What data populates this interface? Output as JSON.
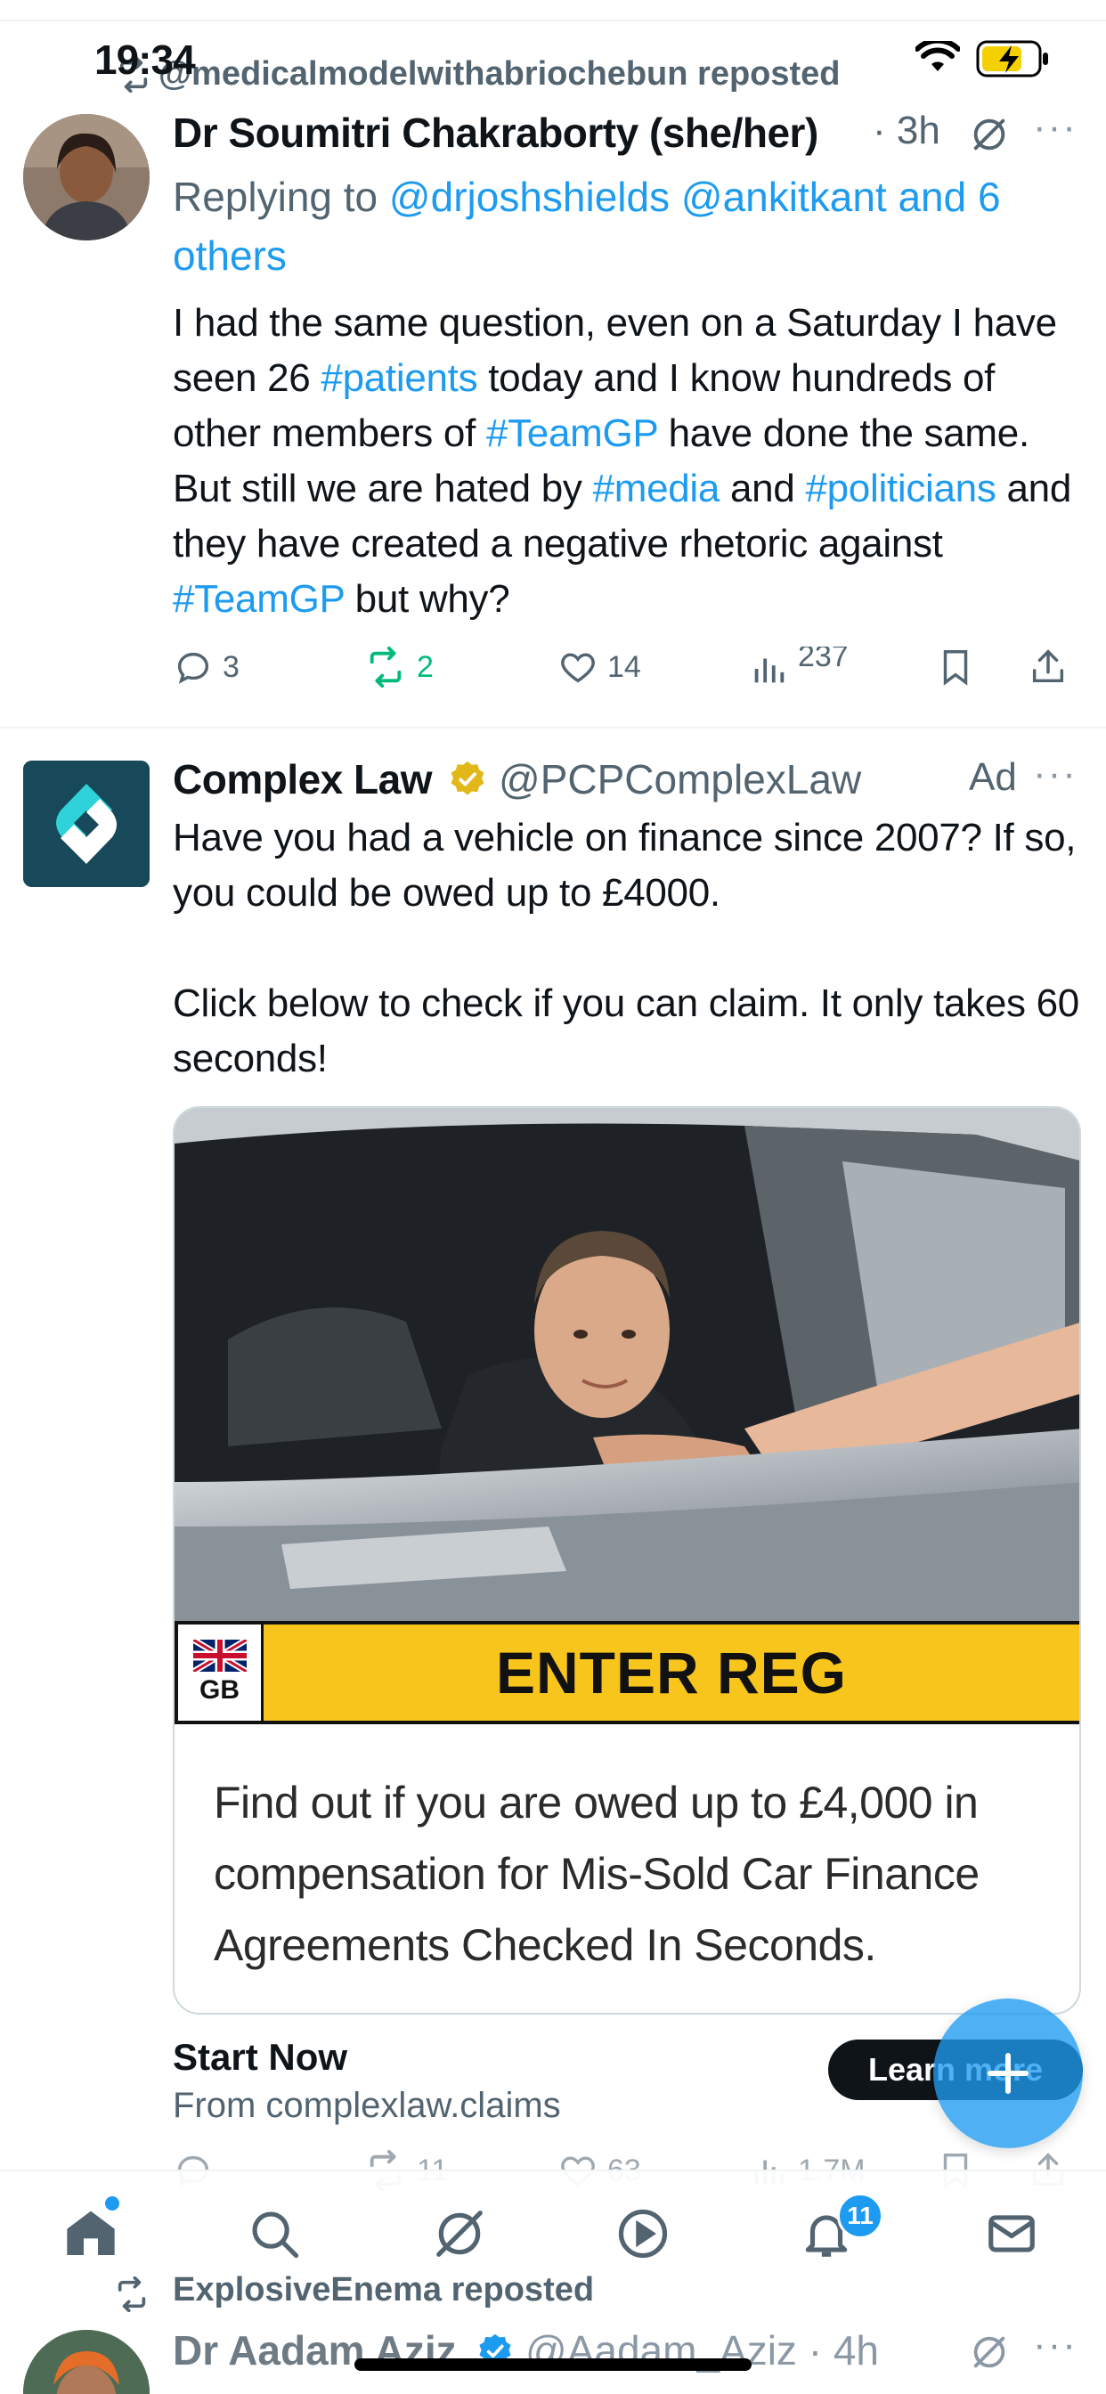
{
  "status_bar": {
    "time": "19:34"
  },
  "tweet1": {
    "repost_text": "@medicalmodelwithabriochebun reposted",
    "author_name": "Dr Soumitri Chakraborty (she/her)",
    "time": "· 3h",
    "reply_prefix": "Replying to ",
    "reply_mentions": "@drjoshshields @ankitkant and 6 others",
    "body_segments": [
      {
        "text": "I had the same question, even on a Saturday I have seen 26 ",
        "link": false
      },
      {
        "text": "#patients",
        "link": true
      },
      {
        "text": " today and I know hundreds of other members of ",
        "link": false
      },
      {
        "text": "#TeamGP",
        "link": true
      },
      {
        "text": " have done the same. But still we are hated by ",
        "link": false
      },
      {
        "text": "#media",
        "link": true
      },
      {
        "text": " and ",
        "link": false
      },
      {
        "text": "#politicians",
        "link": true
      },
      {
        "text": " and they have created a negative rhetoric against ",
        "link": false
      },
      {
        "text": "#TeamGP",
        "link": true
      },
      {
        "text": " but why?",
        "link": false
      }
    ],
    "replies": "3",
    "reposts": "2",
    "likes": "14",
    "views": "237"
  },
  "tweet2": {
    "author_name": "Complex Law",
    "handle": "@PCPComplexLaw",
    "ad_label": "Ad",
    "body": "Have you had a vehicle on finance since 2007? If so, you could be owed up to £4000.\n\nClick below to check if you can claim. It only takes 60 seconds!",
    "card": {
      "plate_country": "GB",
      "plate_cta": "ENTER REG",
      "description": "Find out if you are owed up to £4,000 in compensation for Mis-Sold Car Finance Agreements Checked In Seconds."
    },
    "cta_title": "Start Now",
    "cta_domain": "From complexlaw.claims",
    "learn_more": "Learn more",
    "replies": "",
    "reposts": "11",
    "likes": "63",
    "views": "1.7M"
  },
  "tabbar": {
    "items": [
      "home",
      "search",
      "grok",
      "videos",
      "notifications",
      "messages"
    ],
    "notifications_badge": "11"
  },
  "tweet3": {
    "repost_text": "ExplosiveEnema reposted",
    "author_name": "Dr Aadam Aziz",
    "handle": "@Aadam_Aziz",
    "time": "· 4h"
  },
  "colors": {
    "accent": "#1d9bf0",
    "repost_green": "#00ba7c",
    "muted": "#536471",
    "plate_yellow": "#f8c51c",
    "avatar_teal": "#17495a"
  }
}
